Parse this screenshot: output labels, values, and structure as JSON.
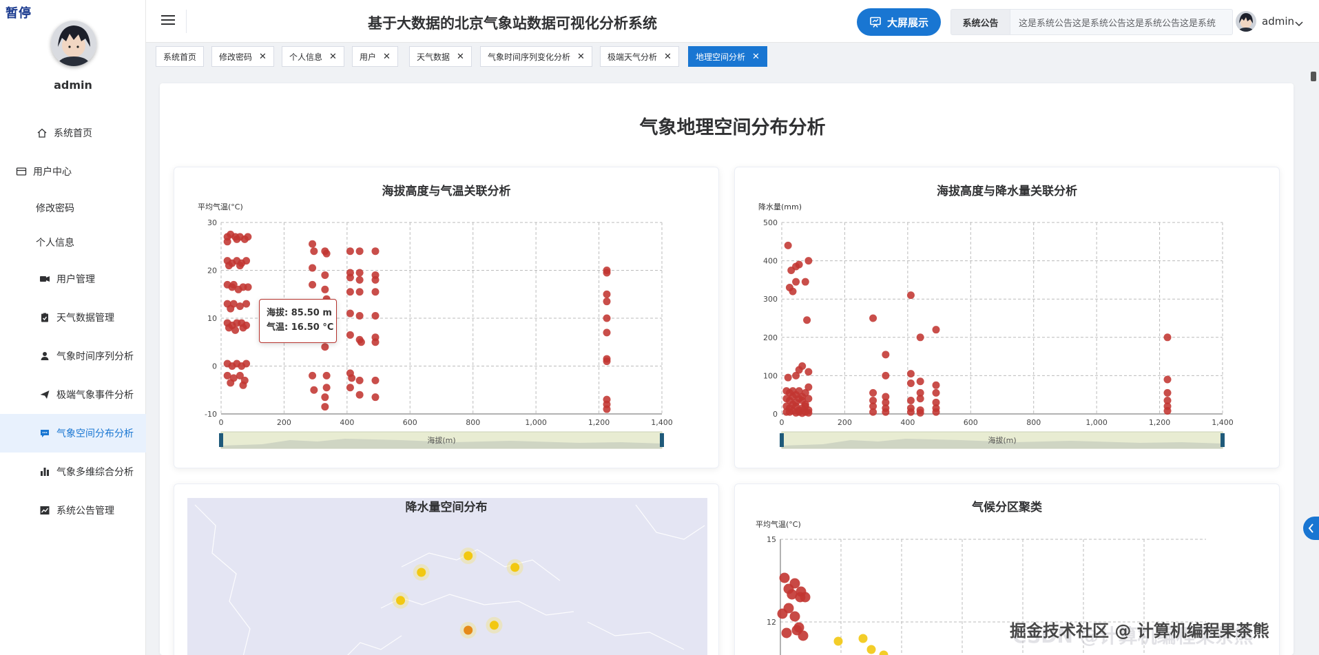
{
  "overlay": {
    "pause_badge": "暂停"
  },
  "sidebar": {
    "username": "admin",
    "items": [
      {
        "label": "系统首页",
        "icon": "home-icon"
      },
      {
        "label": "用户中心",
        "icon": "card-icon"
      },
      {
        "label": "修改密码"
      },
      {
        "label": "个人信息"
      },
      {
        "label": "用户管理",
        "icon": "users-icon"
      },
      {
        "label": "天气数据管理",
        "icon": "clipboard-icon"
      },
      {
        "label": "气象时间序列分析",
        "icon": "person-icon"
      },
      {
        "label": "极端气象事件分析",
        "icon": "send-icon"
      },
      {
        "label": "气象空间分布分析",
        "icon": "chat-icon"
      },
      {
        "label": "气象多维综合分析",
        "icon": "bar-icon"
      },
      {
        "label": "系统公告管理",
        "icon": "trend-icon"
      }
    ]
  },
  "header": {
    "title": "基于大数据的北京气象站数据可视化分析系统",
    "big_screen_label": "大屏展示",
    "notice_label": "系统公告",
    "notice_text": "这是系统公告这是系统公告这是系统公告这是系统",
    "username": "admin"
  },
  "tabs": [
    {
      "label": "系统首页",
      "closable": false
    },
    {
      "label": "修改密码",
      "closable": true
    },
    {
      "label": "个人信息",
      "closable": true
    },
    {
      "label": "用户",
      "closable": true
    },
    {
      "label": "天气数据",
      "closable": true
    },
    {
      "label": "气象时间序列变化分析",
      "closable": true
    },
    {
      "label": "极端天气分析",
      "closable": true
    },
    {
      "label": "地理空间分析",
      "closable": true,
      "active": true
    }
  ],
  "page": {
    "title": "气象地理空间分布分析"
  },
  "tooltip": {
    "line1": "海拔: 85.50 m",
    "line2": "气温: 16.50 °C"
  },
  "colors": {
    "accent": "#1976d2",
    "point_red": "#c23531",
    "point_yellow": "#f2c811"
  },
  "chart_data": [
    {
      "type": "scatter",
      "title": "海拔高度与气温关联分析",
      "xlabel": "",
      "ylabel": "平均气温(°C)",
      "xlim": [
        0,
        1400
      ],
      "ylim": [
        -10,
        30
      ],
      "xticks": [
        0,
        200,
        400,
        600,
        800,
        1000,
        1200,
        1400
      ],
      "xtick_labels": [
        "0",
        "200",
        "400",
        "600",
        "800",
        "1,000",
        "1,200",
        "1,400"
      ],
      "yticks": [
        -10,
        0,
        10,
        20,
        30
      ],
      "zoom_label": "海拔(m)",
      "points": [
        [
          20,
          27
        ],
        [
          30,
          27.5
        ],
        [
          45,
          27
        ],
        [
          60,
          27
        ],
        [
          75,
          26.5
        ],
        [
          85,
          27
        ],
        [
          20,
          26
        ],
        [
          50,
          26.5
        ],
        [
          20,
          22
        ],
        [
          35,
          21.5
        ],
        [
          50,
          22
        ],
        [
          65,
          21.5
        ],
        [
          80,
          22
        ],
        [
          25,
          21
        ],
        [
          60,
          21
        ],
        [
          20,
          17
        ],
        [
          35,
          16.5
        ],
        [
          55,
          16
        ],
        [
          70,
          16.5
        ],
        [
          85.5,
          16.5
        ],
        [
          40,
          17
        ],
        [
          20,
          13
        ],
        [
          40,
          13
        ],
        [
          60,
          12.5
        ],
        [
          80,
          13
        ],
        [
          30,
          12
        ],
        [
          20,
          9
        ],
        [
          35,
          8.5
        ],
        [
          50,
          9
        ],
        [
          65,
          9
        ],
        [
          80,
          8.5
        ],
        [
          25,
          8
        ],
        [
          45,
          7.5
        ],
        [
          70,
          8
        ],
        [
          20,
          0.5
        ],
        [
          35,
          0
        ],
        [
          50,
          0.5
        ],
        [
          65,
          0
        ],
        [
          80,
          0.5
        ],
        [
          20,
          -2
        ],
        [
          40,
          -2.5
        ],
        [
          60,
          -2
        ],
        [
          75,
          -3
        ],
        [
          30,
          -3.5
        ],
        [
          70,
          -4
        ],
        [
          290,
          25.5
        ],
        [
          295,
          24
        ],
        [
          330,
          24
        ],
        [
          335,
          23.5
        ],
        [
          410,
          24
        ],
        [
          440,
          24
        ],
        [
          490,
          24
        ],
        [
          290,
          20.5
        ],
        [
          330,
          19
        ],
        [
          410,
          19.5
        ],
        [
          440,
          19.5
        ],
        [
          490,
          19
        ],
        [
          410,
          18.5
        ],
        [
          440,
          18
        ],
        [
          490,
          18
        ],
        [
          290,
          17
        ],
        [
          330,
          16
        ],
        [
          335,
          14
        ],
        [
          410,
          15.5
        ],
        [
          440,
          15.5
        ],
        [
          490,
          15.5
        ],
        [
          290,
          11
        ],
        [
          330,
          11.5
        ],
        [
          410,
          11
        ],
        [
          440,
          10.5
        ],
        [
          490,
          10.5
        ],
        [
          300,
          7.5
        ],
        [
          335,
          8
        ],
        [
          410,
          6.5
        ],
        [
          440,
          5.5
        ],
        [
          490,
          6
        ],
        [
          445,
          5
        ],
        [
          490,
          5
        ],
        [
          330,
          4
        ],
        [
          290,
          -2
        ],
        [
          335,
          -2
        ],
        [
          410,
          -1.5
        ],
        [
          415,
          -2.5
        ],
        [
          440,
          -3
        ],
        [
          490,
          -3
        ],
        [
          295,
          -5
        ],
        [
          335,
          -4.5
        ],
        [
          410,
          -4.5
        ],
        [
          440,
          -6
        ],
        [
          490,
          -6.5
        ],
        [
          330,
          -6.5
        ],
        [
          330,
          -8.5
        ],
        [
          1225,
          20
        ],
        [
          1225,
          19.5
        ],
        [
          1225,
          15
        ],
        [
          1225,
          13.5
        ],
        [
          1225,
          10
        ],
        [
          1225,
          7
        ],
        [
          1225,
          1.5
        ],
        [
          1225,
          1
        ],
        [
          1225,
          -7
        ],
        [
          1225,
          -8
        ],
        [
          1225,
          -9
        ]
      ]
    },
    {
      "type": "scatter",
      "title": "海拔高度与降水量关联分析",
      "xlabel": "",
      "ylabel": "降水量(mm)",
      "xlim": [
        0,
        1400
      ],
      "ylim": [
        0,
        500
      ],
      "xticks": [
        0,
        200,
        400,
        600,
        800,
        1000,
        1200,
        1400
      ],
      "xtick_labels": [
        "0",
        "200",
        "400",
        "600",
        "800",
        "1,000",
        "1,200",
        "1,400"
      ],
      "yticks": [
        0,
        100,
        200,
        300,
        400,
        500
      ],
      "zoom_label": "海拔(m)",
      "points": [
        [
          20,
          440
        ],
        [
          30,
          375
        ],
        [
          45,
          385
        ],
        [
          55,
          390
        ],
        [
          85,
          400
        ],
        [
          25,
          330
        ],
        [
          35,
          320
        ],
        [
          45,
          345
        ],
        [
          75,
          345
        ],
        [
          80,
          245
        ],
        [
          20,
          95
        ],
        [
          45,
          100
        ],
        [
          55,
          115
        ],
        [
          65,
          125
        ],
        [
          85,
          110
        ],
        [
          15,
          60
        ],
        [
          25,
          55
        ],
        [
          35,
          60
        ],
        [
          45,
          50
        ],
        [
          55,
          60
        ],
        [
          65,
          45
        ],
        [
          75,
          55
        ],
        [
          85,
          70
        ],
        [
          15,
          40
        ],
        [
          25,
          35
        ],
        [
          35,
          45
        ],
        [
          45,
          30
        ],
        [
          55,
          40
        ],
        [
          65,
          35
        ],
        [
          75,
          25
        ],
        [
          85,
          40
        ],
        [
          15,
          20
        ],
        [
          25,
          15
        ],
        [
          35,
          25
        ],
        [
          45,
          20
        ],
        [
          55,
          10
        ],
        [
          65,
          15
        ],
        [
          75,
          20
        ],
        [
          85,
          10
        ],
        [
          15,
          5
        ],
        [
          25,
          5
        ],
        [
          35,
          8
        ],
        [
          45,
          3
        ],
        [
          55,
          5
        ],
        [
          65,
          2
        ],
        [
          75,
          5
        ],
        [
          85,
          3
        ],
        [
          290,
          250
        ],
        [
          330,
          155
        ],
        [
          330,
          100
        ],
        [
          290,
          55
        ],
        [
          330,
          45
        ],
        [
          290,
          35
        ],
        [
          330,
          30
        ],
        [
          290,
          20
        ],
        [
          330,
          15
        ],
        [
          290,
          5
        ],
        [
          330,
          5
        ],
        [
          410,
          310
        ],
        [
          440,
          200
        ],
        [
          490,
          220
        ],
        [
          410,
          105
        ],
        [
          440,
          85
        ],
        [
          490,
          75
        ],
        [
          410,
          80
        ],
        [
          440,
          55
        ],
        [
          490,
          55
        ],
        [
          410,
          35
        ],
        [
          440,
          40
        ],
        [
          490,
          30
        ],
        [
          410,
          15
        ],
        [
          440,
          10
        ],
        [
          490,
          15
        ],
        [
          410,
          5
        ],
        [
          440,
          3
        ],
        [
          490,
          5
        ],
        [
          1225,
          200
        ],
        [
          1225,
          90
        ],
        [
          1225,
          55
        ],
        [
          1225,
          35
        ],
        [
          1225,
          20
        ],
        [
          1225,
          8
        ]
      ]
    },
    {
      "type": "scatter",
      "title": "降水量空间分布",
      "points": [
        [
          0.45,
          0.45
        ],
        [
          0.54,
          0.35
        ],
        [
          0.63,
          0.42
        ],
        [
          0.41,
          0.62
        ],
        [
          0.54,
          0.8
        ],
        [
          0.59,
          0.77
        ]
      ]
    },
    {
      "type": "scatter",
      "title": "气候分区聚类",
      "ylabel": "平均气温(°C)",
      "yticks": [
        15,
        12
      ],
      "ylim": [
        9,
        15
      ],
      "clusters": [
        {
          "color": "red",
          "points": [
            [
              0.1,
              13.6
            ],
            [
              0.2,
              13.2
            ],
            [
              0.35,
              13.4
            ],
            [
              0.5,
              13.1
            ],
            [
              0.6,
              12.9
            ],
            [
              0.2,
              12.5
            ],
            [
              0.35,
              12.2
            ],
            [
              0.05,
              12.3
            ],
            [
              0.45,
              11.8
            ],
            [
              0.55,
              11.5
            ],
            [
              0.15,
              11.6
            ],
            [
              0.4,
              11.7
            ],
            [
              0.28,
              13.0
            ],
            [
              0.48,
              12.9
            ]
          ]
        },
        {
          "color": "yellow",
          "points": [
            [
              1.4,
              11.3
            ],
            [
              2.0,
              11.4
            ],
            [
              2.2,
              11.0
            ],
            [
              2.5,
              10.8
            ],
            [
              1.6,
              10.0
            ]
          ]
        }
      ]
    }
  ],
  "watermark": {
    "text": "掘金技术社区 @ 计算机编程果茶熊",
    "bg_text": "CSDN @计算机编程果茶熊"
  }
}
